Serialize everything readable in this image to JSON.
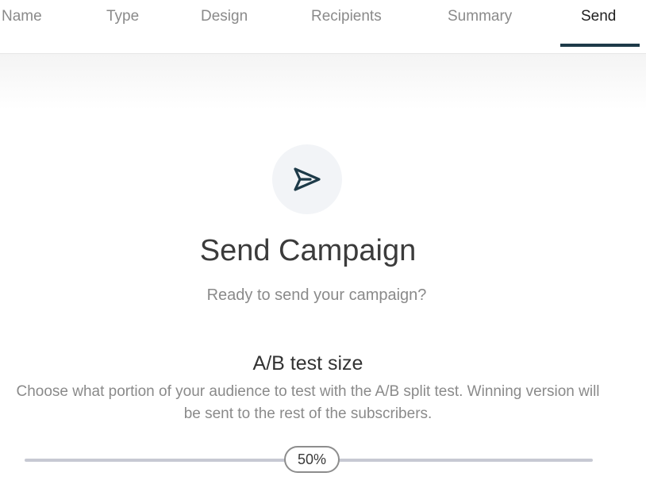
{
  "tabs": [
    {
      "label": "Name",
      "active": false
    },
    {
      "label": "Type",
      "active": false
    },
    {
      "label": "Design",
      "active": false
    },
    {
      "label": "Recipients",
      "active": false
    },
    {
      "label": "Summary",
      "active": false
    },
    {
      "label": "Send",
      "active": true
    }
  ],
  "send": {
    "icon": "send-paper-plane-icon",
    "title": "Send Campaign",
    "subtitle": "Ready to send your campaign?"
  },
  "ab_test": {
    "title": "A/B test size",
    "description": "Choose what portion of your audience to test with the A/B split test. Winning version will be sent to the rest of the subscribers.",
    "slider_value_label": "50%",
    "slider_value": 50
  },
  "colors": {
    "accent": "#1d3a48",
    "muted_text": "#8a8a8a",
    "icon_bg": "#f2f4f7",
    "track": "#c7c9d3"
  }
}
